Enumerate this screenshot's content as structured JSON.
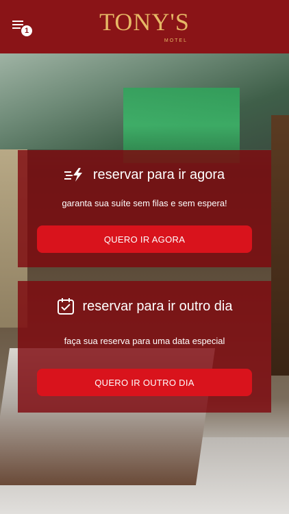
{
  "header": {
    "menu_icon": "menu-lines-icon",
    "notification_count": "1",
    "logo_name": "TONY'S",
    "logo_sub": "MOTEL",
    "brand_color": "#8a1417",
    "logo_color": "#e6b866"
  },
  "cards": {
    "now": {
      "icon": "fast-lightning-icon",
      "title": "reservar para ir agora",
      "description": "garanta sua suíte sem filas e sem espera!",
      "button_label": "QUERO IR AGORA"
    },
    "later": {
      "icon": "calendar-check-icon",
      "title": "reservar para ir outro dia",
      "description": "faça sua reserva para uma data especial",
      "button_label": "QUERO IR OUTRO DIA"
    },
    "button_color": "#d9131c",
    "card_color": "#7e060c"
  }
}
